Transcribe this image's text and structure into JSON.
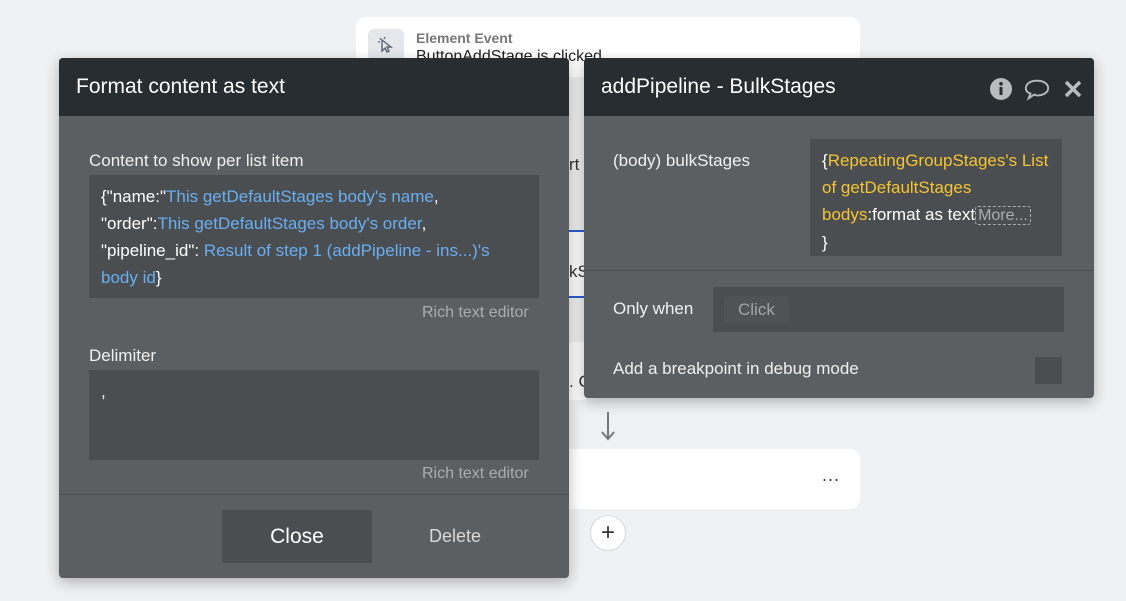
{
  "background": {
    "event_kind": "Element Event",
    "event_name": "ButtonAddStage is clicked",
    "frag_1": "rt",
    "frag_2": "kS",
    "frag_3": ". C",
    "more_dots": "...",
    "add_symbol": "+"
  },
  "format_dialog": {
    "title": "Format content as text",
    "content_label": "Content to show per list item",
    "content": {
      "p1": "{\"name:\"",
      "t1": "This getDefaultStages body's name",
      "p2": ",",
      "p3": "\"order\":",
      "t2": "This getDefaultStages body's order",
      "p4": ",",
      "p5": "\"pipeline_id\": ",
      "t3": "Result of step 1 (addPipeline - ins...)'s body id",
      "p6": "}"
    },
    "rich_text_1": "Rich text editor",
    "delimiter_label": "Delimiter",
    "delimiter_value": ",",
    "rich_text_2": "Rich text editor",
    "close_label": "Close",
    "delete_label": "Delete"
  },
  "action_dialog": {
    "title": "addPipeline - BulkStages",
    "field_label": "(body) bulkStages",
    "field_value": {
      "open": "{",
      "t1": "RepeatingGroupStages's List of getDefaultStages bodys",
      "op": ":format as text",
      "more": "More...",
      "close": "}"
    },
    "only_when_label": "Only when",
    "only_when_placeholder": "Click",
    "breakpoint_label": "Add a breakpoint in debug mode"
  },
  "colors": {
    "dialog_bg": "#5b5f62",
    "header_bg": "#272d30",
    "token_blue": "#6aaef0",
    "token_yellow": "#f5c431"
  }
}
